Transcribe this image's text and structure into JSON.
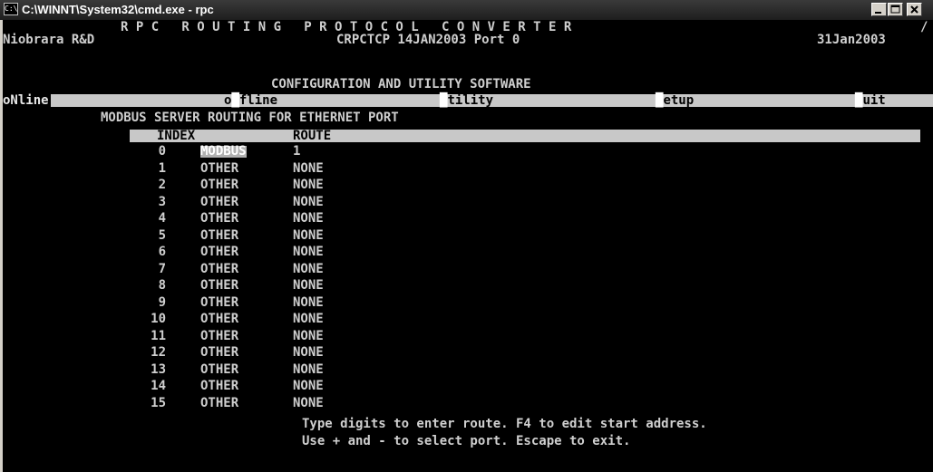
{
  "window": {
    "icon_glyph": "C:\\",
    "title": "C:\\WINNT\\System32\\cmd.exe - rpc"
  },
  "header": {
    "banner": "R P C   R O U T I N G   P R O T O C O L   C O N V E R T E R",
    "banner_tail": "/",
    "company": "Niobrara R&D",
    "version": "CRPCTCP 14JAN2003 Port 0",
    "date": "31Jan2003",
    "subtitle": "CONFIGURATION AND UTILITY SOFTWARE"
  },
  "menu": {
    "online": "oNline",
    "offline_hot": "o",
    "offline_rest": "fline",
    "utility_rest": "tility",
    "setup_rest": "etup",
    "quit_rest": "uit"
  },
  "section_title": "MODBUS SERVER ROUTING FOR ETHERNET PORT",
  "table": {
    "headers": {
      "index": "INDEX",
      "route": "ROUTE"
    },
    "rows": [
      {
        "index": "0",
        "type": "MODBUS",
        "route": "1"
      },
      {
        "index": "1",
        "type": "OTHER",
        "route": "NONE"
      },
      {
        "index": "2",
        "type": "OTHER",
        "route": "NONE"
      },
      {
        "index": "3",
        "type": "OTHER",
        "route": "NONE"
      },
      {
        "index": "4",
        "type": "OTHER",
        "route": "NONE"
      },
      {
        "index": "5",
        "type": "OTHER",
        "route": "NONE"
      },
      {
        "index": "6",
        "type": "OTHER",
        "route": "NONE"
      },
      {
        "index": "7",
        "type": "OTHER",
        "route": "NONE"
      },
      {
        "index": "8",
        "type": "OTHER",
        "route": "NONE"
      },
      {
        "index": "9",
        "type": "OTHER",
        "route": "NONE"
      },
      {
        "index": "10",
        "type": "OTHER",
        "route": "NONE"
      },
      {
        "index": "11",
        "type": "OTHER",
        "route": "NONE"
      },
      {
        "index": "12",
        "type": "OTHER",
        "route": "NONE"
      },
      {
        "index": "13",
        "type": "OTHER",
        "route": "NONE"
      },
      {
        "index": "14",
        "type": "OTHER",
        "route": "NONE"
      },
      {
        "index": "15",
        "type": "OTHER",
        "route": "NONE"
      }
    ],
    "selected_row": 0
  },
  "help": {
    "line1": "Type digits to enter route. F4 to edit start address.",
    "line2": "Use + and - to select port. Escape to exit."
  }
}
